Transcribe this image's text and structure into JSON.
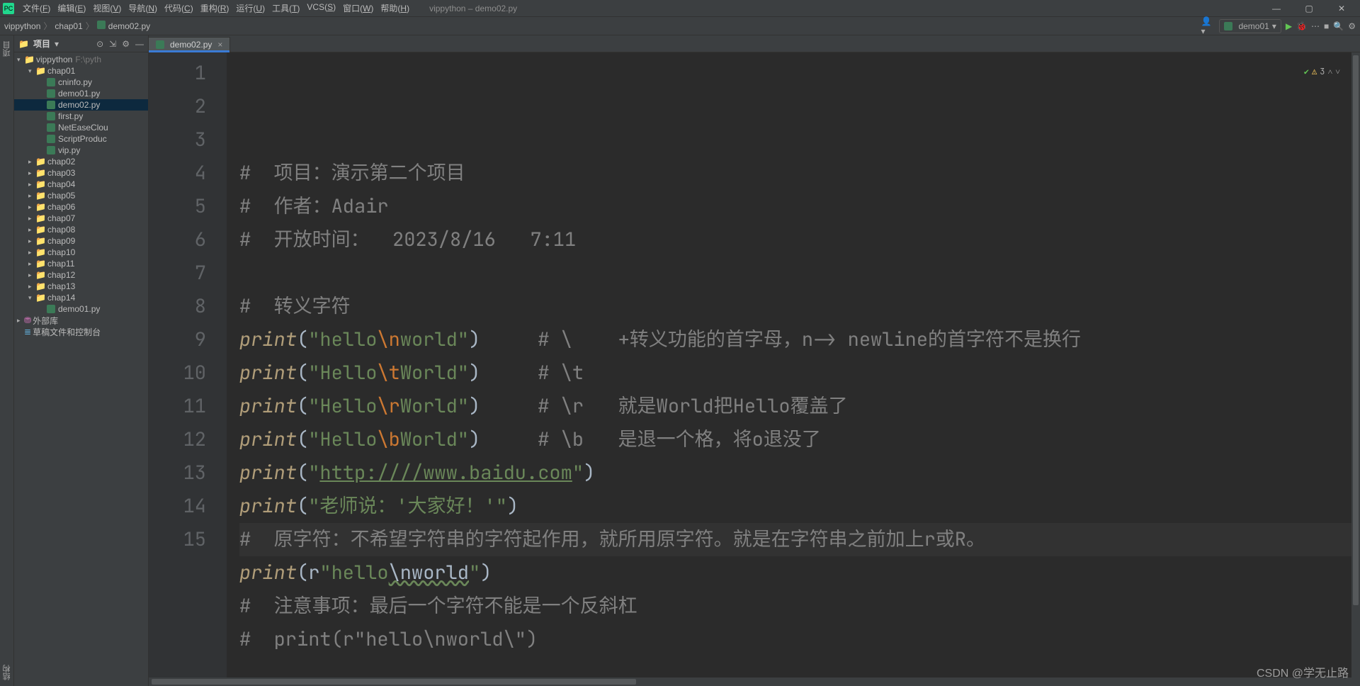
{
  "window": {
    "title": "vippython – demo02.py"
  },
  "menu": [
    {
      "label": "文件",
      "u": "F"
    },
    {
      "label": "编辑",
      "u": "E"
    },
    {
      "label": "视图",
      "u": "V"
    },
    {
      "label": "导航",
      "u": "N"
    },
    {
      "label": "代码",
      "u": "C"
    },
    {
      "label": "重构",
      "u": "R"
    },
    {
      "label": "运行",
      "u": "U"
    },
    {
      "label": "工具",
      "u": "T"
    },
    {
      "label": "VCS",
      "u": "S"
    },
    {
      "label": "窗口",
      "u": "W"
    },
    {
      "label": "帮助",
      "u": "H"
    }
  ],
  "breadcrumbs": [
    {
      "t": "vippython",
      "icon": null
    },
    {
      "t": "chap01",
      "icon": null
    },
    {
      "t": "demo02.py",
      "icon": "py"
    }
  ],
  "run_config": "demo01",
  "project_panel": {
    "title": "项目"
  },
  "left_rail": {
    "top": "项目",
    "bottom": "结构"
  },
  "tree": [
    {
      "d": 0,
      "fold": "▾",
      "ico": "dir",
      "label": "vippython",
      "hint": "F:\\pyth"
    },
    {
      "d": 1,
      "fold": "▾",
      "ico": "dir",
      "label": "chap01"
    },
    {
      "d": 2,
      "fold": "",
      "ico": "py",
      "label": "cninfo.py"
    },
    {
      "d": 2,
      "fold": "",
      "ico": "py",
      "label": "demo01.py"
    },
    {
      "d": 2,
      "fold": "",
      "ico": "py",
      "label": "demo02.py",
      "sel": true
    },
    {
      "d": 2,
      "fold": "",
      "ico": "py",
      "label": "first.py"
    },
    {
      "d": 2,
      "fold": "",
      "ico": "py",
      "label": "NetEaseClou"
    },
    {
      "d": 2,
      "fold": "",
      "ico": "py",
      "label": "ScriptProduc"
    },
    {
      "d": 2,
      "fold": "",
      "ico": "py",
      "label": "vip.py"
    },
    {
      "d": 1,
      "fold": "▸",
      "ico": "dir",
      "label": "chap02"
    },
    {
      "d": 1,
      "fold": "▸",
      "ico": "dir",
      "label": "chap03"
    },
    {
      "d": 1,
      "fold": "▸",
      "ico": "dir",
      "label": "chap04"
    },
    {
      "d": 1,
      "fold": "▸",
      "ico": "dir",
      "label": "chap05"
    },
    {
      "d": 1,
      "fold": "▸",
      "ico": "dir",
      "label": "chap06"
    },
    {
      "d": 1,
      "fold": "▸",
      "ico": "dir",
      "label": "chap07"
    },
    {
      "d": 1,
      "fold": "▸",
      "ico": "dir",
      "label": "chap08"
    },
    {
      "d": 1,
      "fold": "▸",
      "ico": "dir",
      "label": "chap09"
    },
    {
      "d": 1,
      "fold": "▸",
      "ico": "dir",
      "label": "chap10"
    },
    {
      "d": 1,
      "fold": "▸",
      "ico": "dir",
      "label": "chap11"
    },
    {
      "d": 1,
      "fold": "▸",
      "ico": "dir",
      "label": "chap12"
    },
    {
      "d": 1,
      "fold": "▸",
      "ico": "dir",
      "label": "chap13"
    },
    {
      "d": 1,
      "fold": "▾",
      "ico": "dir",
      "label": "chap14"
    },
    {
      "d": 2,
      "fold": "",
      "ico": "py",
      "label": "demo01.py"
    },
    {
      "d": 0,
      "fold": "▸",
      "ico": "lib",
      "label": "外部库"
    },
    {
      "d": 0,
      "fold": "",
      "ico": "scratch",
      "label": "草稿文件和控制台"
    }
  ],
  "tab": {
    "label": "demo02.py"
  },
  "status": {
    "warnings": "3",
    "more": "^",
    "up": "v"
  },
  "code_lines": [
    {
      "n": 1,
      "seg": [
        {
          "c": "comment",
          "t": "#  项目：演示第二个项目"
        }
      ]
    },
    {
      "n": 2,
      "seg": [
        {
          "c": "comment",
          "t": "#  作者：Adair"
        }
      ]
    },
    {
      "n": 3,
      "seg": [
        {
          "c": "comment",
          "t": "#  开放时间：  2023/8/16   7:11"
        }
      ]
    },
    {
      "n": 4,
      "seg": []
    },
    {
      "n": 5,
      "seg": [
        {
          "c": "comment",
          "t": "#  转义字符"
        }
      ]
    },
    {
      "n": 6,
      "seg": [
        {
          "c": "fn",
          "t": "print"
        },
        {
          "c": "",
          "t": "("
        },
        {
          "c": "str",
          "t": "\"hello"
        },
        {
          "c": "esc",
          "t": "\\n"
        },
        {
          "c": "str",
          "t": "world\""
        },
        {
          "c": "",
          "t": ")     "
        },
        {
          "c": "comment",
          "t": "# \\    +转义功能的首字母，n-> newline的首字符不是换行"
        }
      ]
    },
    {
      "n": 7,
      "seg": [
        {
          "c": "fn",
          "t": "print"
        },
        {
          "c": "",
          "t": "("
        },
        {
          "c": "str",
          "t": "\"Hello"
        },
        {
          "c": "esc",
          "t": "\\t"
        },
        {
          "c": "str",
          "t": "World\""
        },
        {
          "c": "",
          "t": ")     "
        },
        {
          "c": "comment",
          "t": "# \\t"
        }
      ]
    },
    {
      "n": 8,
      "seg": [
        {
          "c": "fn",
          "t": "print"
        },
        {
          "c": "",
          "t": "("
        },
        {
          "c": "str",
          "t": "\"Hello"
        },
        {
          "c": "esc",
          "t": "\\r"
        },
        {
          "c": "str",
          "t": "World\""
        },
        {
          "c": "",
          "t": ")     "
        },
        {
          "c": "comment",
          "t": "# \\r   就是World把Hello覆盖了"
        }
      ]
    },
    {
      "n": 9,
      "seg": [
        {
          "c": "fn",
          "t": "print"
        },
        {
          "c": "",
          "t": "("
        },
        {
          "c": "str",
          "t": "\"Hello"
        },
        {
          "c": "esc",
          "t": "\\b"
        },
        {
          "c": "str",
          "t": "World\""
        },
        {
          "c": "",
          "t": ")     "
        },
        {
          "c": "comment",
          "t": "# \\b   是退一个格，将o退没了"
        }
      ]
    },
    {
      "n": 10,
      "seg": [
        {
          "c": "fn",
          "t": "print"
        },
        {
          "c": "",
          "t": "("
        },
        {
          "c": "str",
          "t": "\""
        },
        {
          "c": "url",
          "t": "http:////www.baidu.com"
        },
        {
          "c": "str",
          "t": "\""
        },
        {
          "c": "",
          "t": ")"
        }
      ]
    },
    {
      "n": 11,
      "seg": [
        {
          "c": "fn",
          "t": "print"
        },
        {
          "c": "",
          "t": "("
        },
        {
          "c": "str",
          "t": "\"老师说：'大家好！'\""
        },
        {
          "c": "",
          "t": ")"
        }
      ]
    },
    {
      "n": 12,
      "caret": true,
      "seg": [
        {
          "c": "comment",
          "t": "#  原字符：不希望字符串的字符起作用，就所用原字符。就是在字符串之前加上r或R。"
        }
      ]
    },
    {
      "n": 13,
      "seg": [
        {
          "c": "fn",
          "t": "print"
        },
        {
          "c": "",
          "t": "("
        },
        {
          "c": "",
          "t": "r"
        },
        {
          "c": "str",
          "t": "\"hello"
        },
        {
          "c": "typo",
          "t": "\\nworld"
        },
        {
          "c": "str",
          "t": "\""
        },
        {
          "c": "",
          "t": ")"
        }
      ]
    },
    {
      "n": 14,
      "seg": [
        {
          "c": "comment",
          "t": "#  注意事项：最后一个字符不能是一个反斜杠"
        }
      ]
    },
    {
      "n": 15,
      "seg": [
        {
          "c": "comment",
          "t": "#  print(r\"hello\\nworld\\\")"
        }
      ]
    }
  ],
  "watermark": "CSDN @学无止路"
}
